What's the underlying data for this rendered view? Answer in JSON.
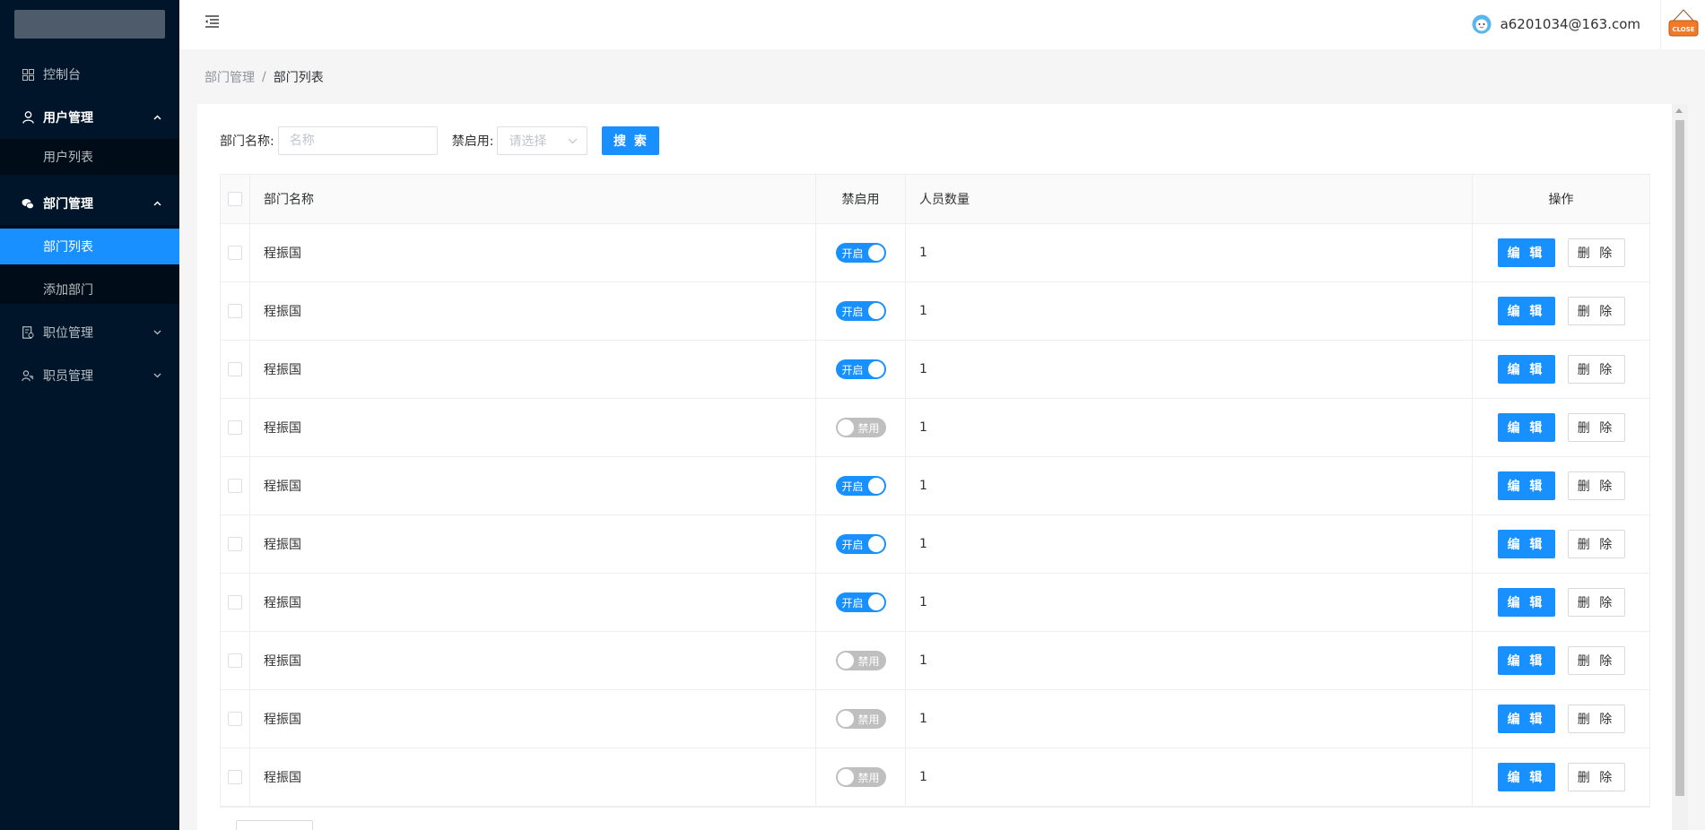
{
  "sidebar": {
    "items": [
      {
        "label": "控制台",
        "icon": "dashboard-icon"
      },
      {
        "label": "用户管理",
        "icon": "user-icon",
        "expanded": true,
        "children": [
          {
            "label": "用户列表"
          }
        ]
      },
      {
        "label": "部门管理",
        "icon": "wechat-icon",
        "expanded": true,
        "children": [
          {
            "label": "部门列表",
            "active": true
          },
          {
            "label": "添加部门"
          }
        ]
      },
      {
        "label": "职位管理",
        "icon": "audit-icon",
        "expanded": false
      },
      {
        "label": "职员管理",
        "icon": "team-icon",
        "expanded": false
      }
    ]
  },
  "header": {
    "user_email": "a6201034@163.com",
    "close_label": "CLOSE"
  },
  "breadcrumb": {
    "parent": "部门管理",
    "separator": "/",
    "current": "部门列表"
  },
  "search": {
    "name_label": "部门名称:",
    "name_placeholder": "名称",
    "status_label": "禁启用:",
    "status_placeholder": "请选择",
    "search_button": "搜 索"
  },
  "table": {
    "columns": [
      "部门名称",
      "禁启用",
      "人员数量",
      "操作"
    ],
    "rows": [
      {
        "name": "程振国",
        "enabled": true,
        "status_text": "开启",
        "count": "1"
      },
      {
        "name": "程振国",
        "enabled": true,
        "status_text": "开启",
        "count": "1"
      },
      {
        "name": "程振国",
        "enabled": true,
        "status_text": "开启",
        "count": "1"
      },
      {
        "name": "程振国",
        "enabled": false,
        "status_text": "禁用",
        "count": "1"
      },
      {
        "name": "程振国",
        "enabled": true,
        "status_text": "开启",
        "count": "1"
      },
      {
        "name": "程振国",
        "enabled": true,
        "status_text": "开启",
        "count": "1"
      },
      {
        "name": "程振国",
        "enabled": true,
        "status_text": "开启",
        "count": "1"
      },
      {
        "name": "程振国",
        "enabled": false,
        "status_text": "禁用",
        "count": "1"
      },
      {
        "name": "程振国",
        "enabled": false,
        "status_text": "禁用",
        "count": "1"
      },
      {
        "name": "程振国",
        "enabled": false,
        "status_text": "禁用",
        "count": "1"
      }
    ],
    "edit_label": "编 辑",
    "delete_label": "删 除"
  },
  "colors": {
    "sidebar_bg": "#001529",
    "submenu_bg": "#000c17",
    "primary": "#1890ff",
    "switch_off": "#bfbfbf"
  }
}
